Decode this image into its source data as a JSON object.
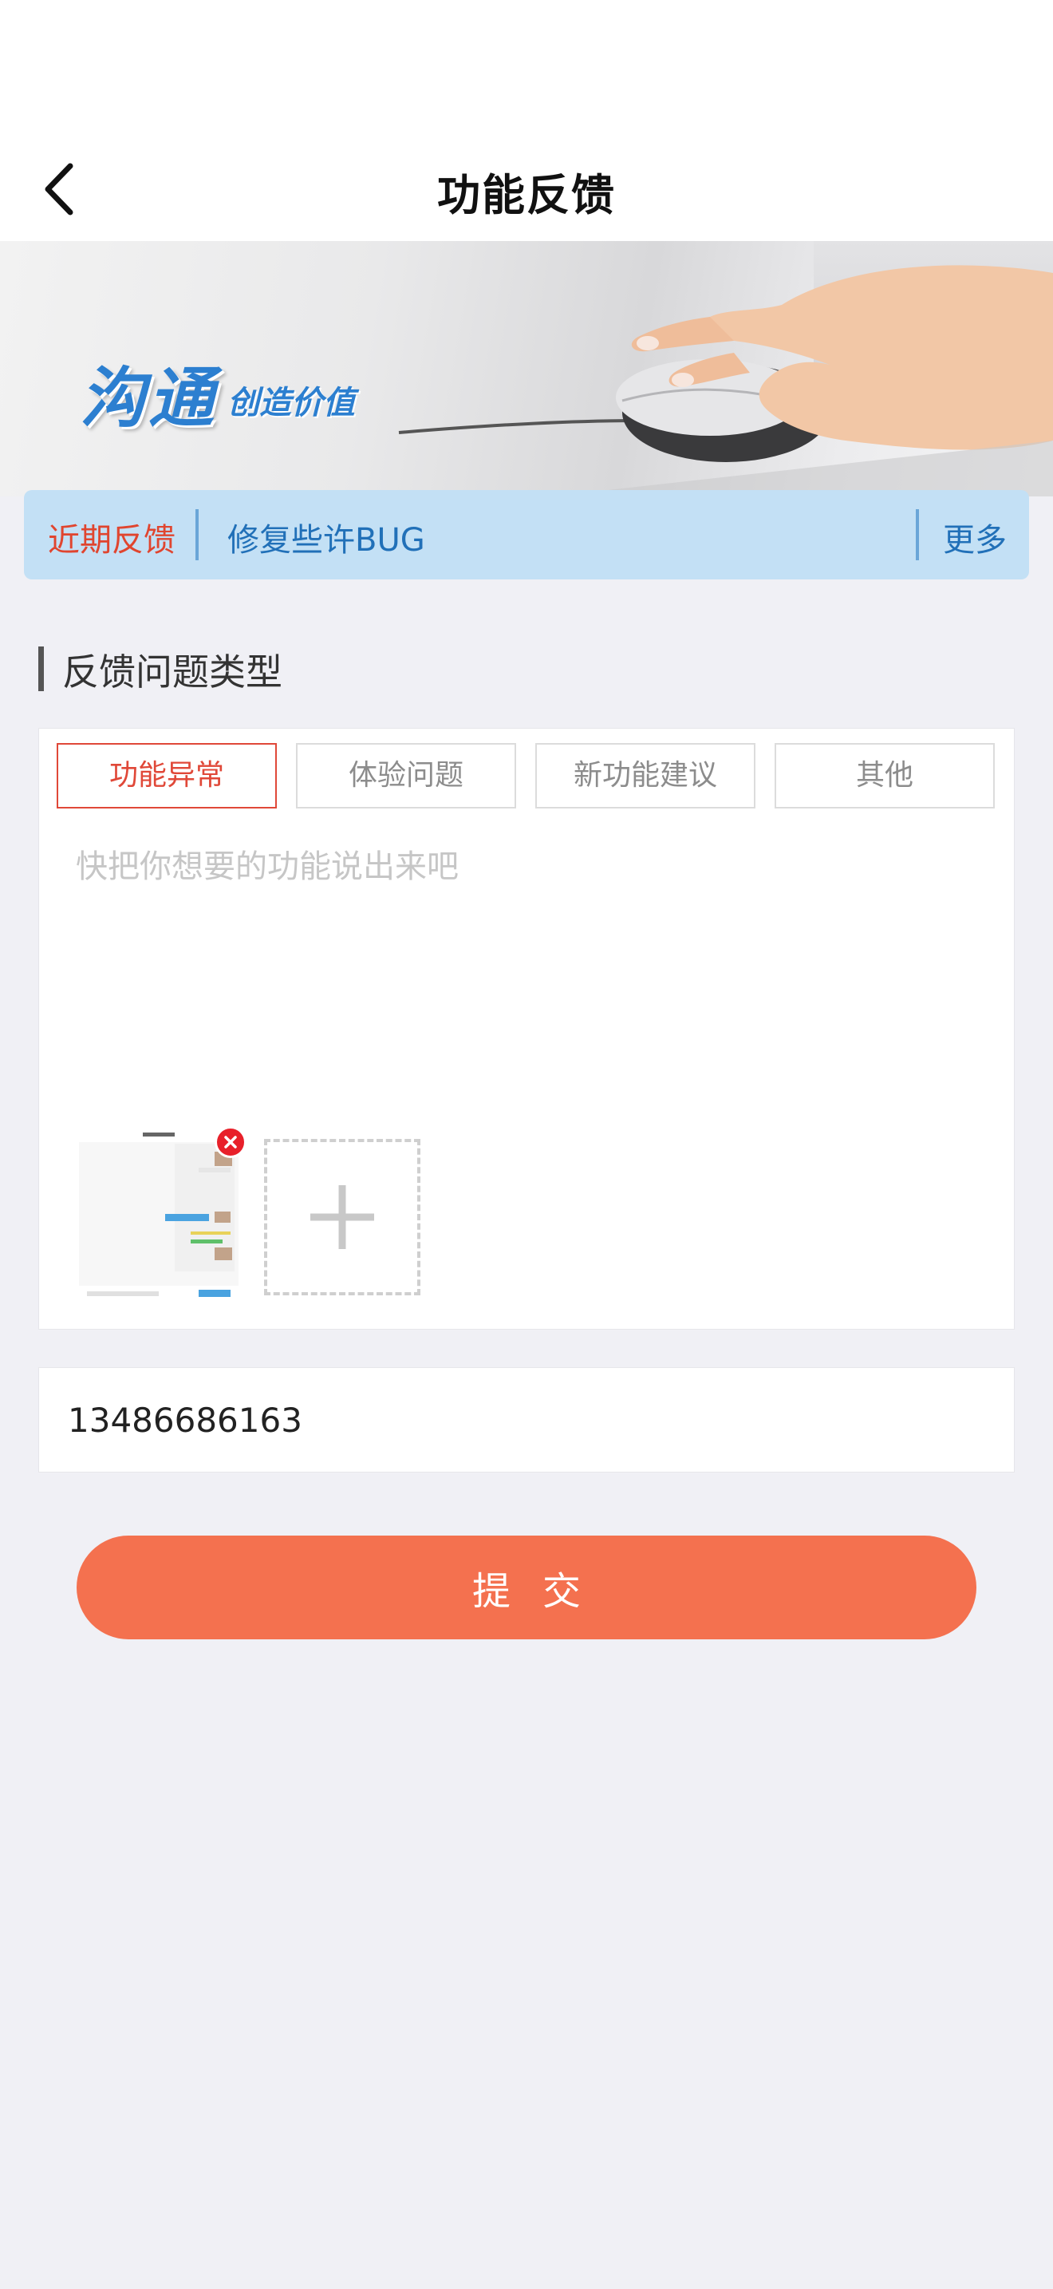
{
  "header": {
    "title": "功能反馈",
    "back_icon": "chevron-left-icon"
  },
  "banner": {
    "slogan_main": "沟通",
    "slogan_sub": "创造价值"
  },
  "notice": {
    "label": "近期反馈",
    "text": "修复些许BUG",
    "more": "更多"
  },
  "section": {
    "title": "反馈问题类型"
  },
  "feedback": {
    "types": [
      {
        "label": "功能异常",
        "selected": true
      },
      {
        "label": "体验问题",
        "selected": false
      },
      {
        "label": "新功能建议",
        "selected": false
      },
      {
        "label": "其他",
        "selected": false
      }
    ],
    "placeholder": "快把你想要的功能说出来吧",
    "value": "",
    "attachments": [
      {
        "icon": "screenshot-thumbnail"
      }
    ],
    "add_icon": "plus-icon",
    "remove_icon": "close-icon"
  },
  "contact": {
    "value": "13486686163"
  },
  "submit": {
    "label": "提交"
  },
  "colors": {
    "accent": "#f4714f",
    "selected_tab": "#e04838",
    "notice_bg": "#c3e0f5",
    "notice_text": "#2170b8",
    "brand_blue": "#2c7fd0"
  }
}
